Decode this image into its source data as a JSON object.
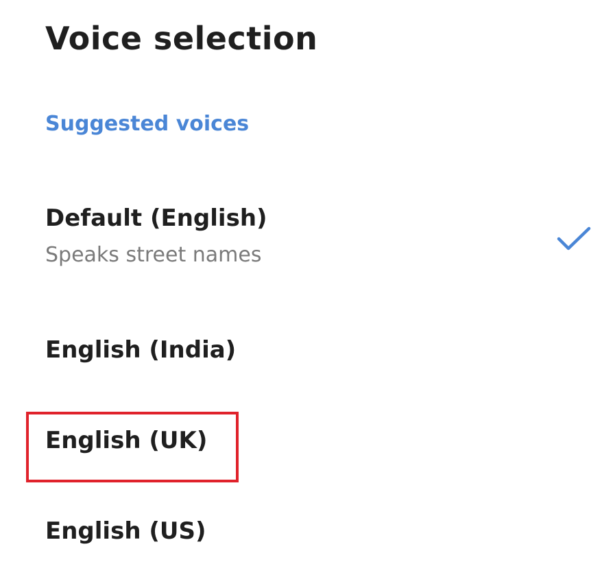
{
  "page": {
    "title": "Voice selection"
  },
  "section": {
    "header": "Suggested voices"
  },
  "voices": [
    {
      "label": "Default (English)",
      "subtitle": "Speaks street names",
      "selected": true
    },
    {
      "label": "English (India)",
      "selected": false
    },
    {
      "label": "English (UK)",
      "selected": false,
      "highlighted": true
    },
    {
      "label": "English (US)",
      "selected": false
    }
  ],
  "icons": {
    "selected": "check-icon"
  },
  "colors": {
    "accent": "#4a86d6",
    "highlight": "#e0222b",
    "subtitle": "#7a7a7a"
  }
}
